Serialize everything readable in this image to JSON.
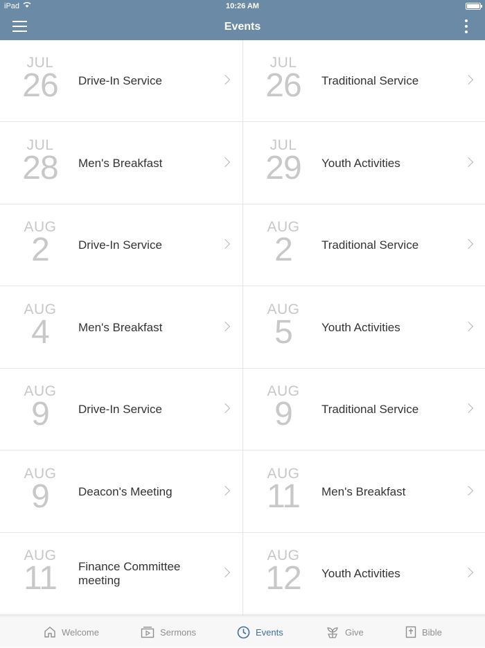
{
  "status": {
    "carrier": "iPad",
    "time": "10:26 AM"
  },
  "header": {
    "title": "Events"
  },
  "events": [
    {
      "month": "JUL",
      "day": "26",
      "title": "Drive-In Service"
    },
    {
      "month": "JUL",
      "day": "26",
      "title": "Traditional Service"
    },
    {
      "month": "JUL",
      "day": "28",
      "title": "Men's Breakfast"
    },
    {
      "month": "JUL",
      "day": "29",
      "title": "Youth Activities"
    },
    {
      "month": "AUG",
      "day": "2",
      "title": "Drive-In Service"
    },
    {
      "month": "AUG",
      "day": "2",
      "title": "Traditional Service"
    },
    {
      "month": "AUG",
      "day": "4",
      "title": "Men's Breakfast"
    },
    {
      "month": "AUG",
      "day": "5",
      "title": "Youth Activities"
    },
    {
      "month": "AUG",
      "day": "9",
      "title": "Drive-In Service"
    },
    {
      "month": "AUG",
      "day": "9",
      "title": "Traditional Service"
    },
    {
      "month": "AUG",
      "day": "9",
      "title": "Deacon's Meeting"
    },
    {
      "month": "AUG",
      "day": "11",
      "title": "Men's Breakfast"
    },
    {
      "month": "AUG",
      "day": "11",
      "title": "Finance Committee meeting"
    },
    {
      "month": "AUG",
      "day": "12",
      "title": "Youth Activities"
    }
  ],
  "tabs": [
    {
      "label": "Welcome",
      "icon": "home-icon"
    },
    {
      "label": "Sermons",
      "icon": "video-icon"
    },
    {
      "label": "Events",
      "icon": "clock-icon",
      "active": true
    },
    {
      "label": "Give",
      "icon": "plant-icon"
    },
    {
      "label": "Bible",
      "icon": "bible-icon"
    }
  ],
  "colors": {
    "header": "#6b8aa5",
    "active_tab": "#3f6f9a",
    "date_text": "#c8c8c8"
  }
}
